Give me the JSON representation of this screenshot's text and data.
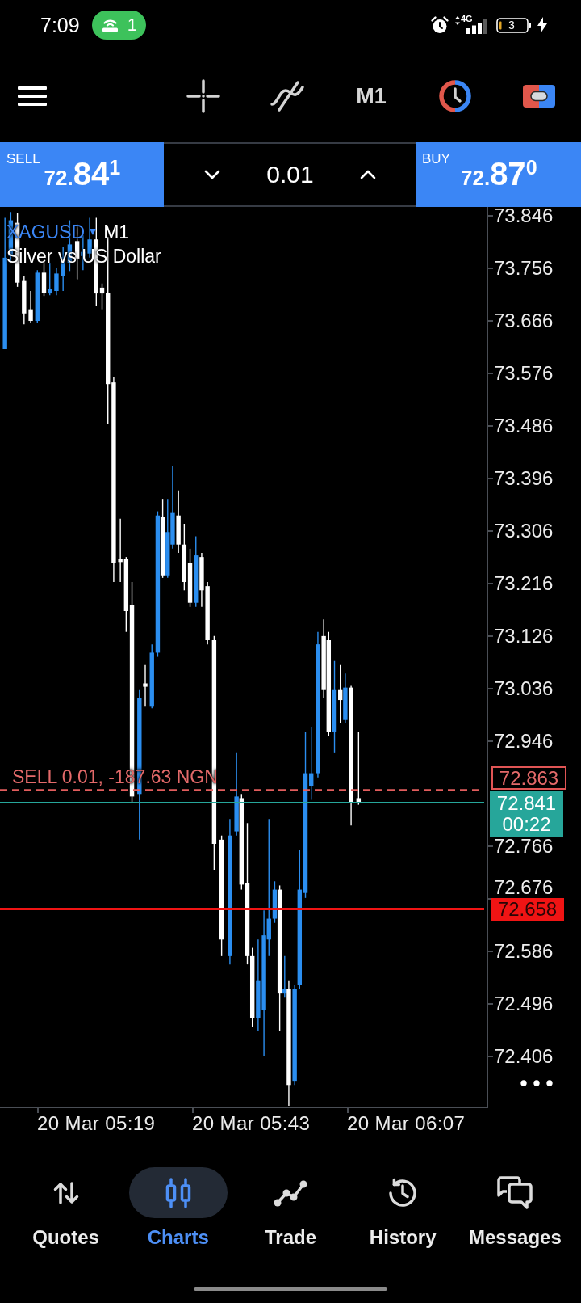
{
  "status_bar": {
    "time": "7:09",
    "hotspot_count": "1",
    "network": "4G",
    "battery": "3"
  },
  "toolbar": {
    "timeframe": "M1"
  },
  "trade_panel": {
    "sell": {
      "label": "SELL",
      "price": {
        "prefix": "72.",
        "main": "84",
        "pip": "1"
      }
    },
    "volume": "0.01",
    "buy": {
      "label": "BUY",
      "price": {
        "prefix": "72.",
        "main": "87",
        "pip": "0"
      }
    }
  },
  "chart": {
    "symbol": "XAGUSD",
    "timeframe": "M1",
    "description": "Silver vs US Dollar",
    "price_axis": [
      "73.846",
      "73.756",
      "73.666",
      "73.576",
      "73.486",
      "73.396",
      "73.306",
      "73.216",
      "73.126",
      "73.036",
      "72.946",
      "72.766",
      "72.676",
      "72.586",
      "72.496",
      "72.406"
    ],
    "price_lines": [
      {
        "kind": "order",
        "label": "SELL 0.01, -187.63 NGN",
        "price": "72.863"
      },
      {
        "kind": "bid",
        "price": "72.841",
        "timer": "00:22"
      },
      {
        "kind": "level",
        "price": "72.658"
      }
    ],
    "time_axis": [
      "20 Mar 05:19",
      "20 Mar 05:43",
      "20 Mar 06:07"
    ]
  },
  "bottom_nav": [
    {
      "label": "Quotes",
      "selected": false
    },
    {
      "label": "Charts",
      "selected": true
    },
    {
      "label": "Trade",
      "selected": false
    },
    {
      "label": "History",
      "selected": false
    },
    {
      "label": "Messages",
      "selected": false
    }
  ]
}
